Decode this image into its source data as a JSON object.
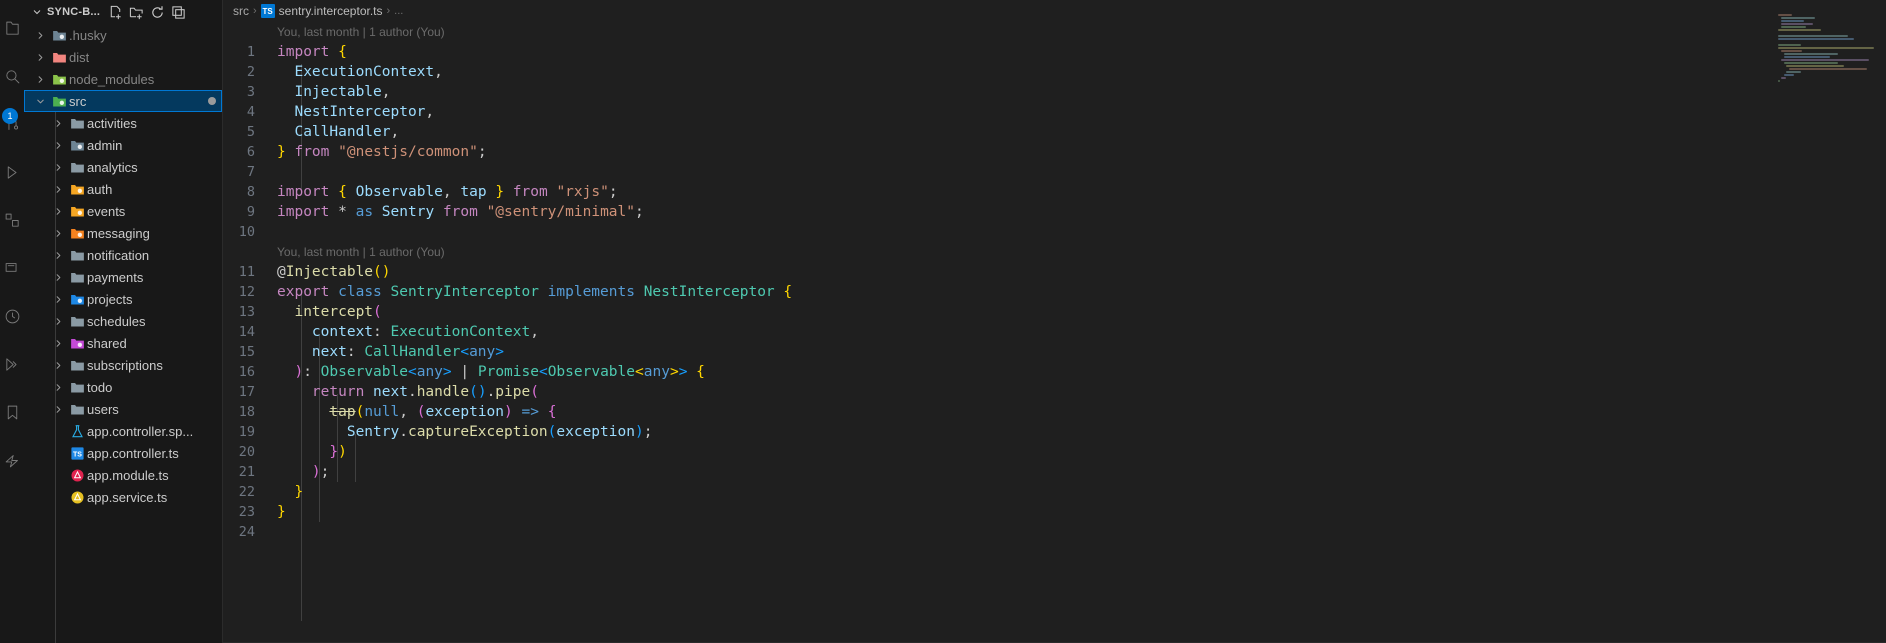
{
  "activity_bar": {
    "items": [
      {
        "name": "explorer-icon",
        "badge": null
      },
      {
        "name": "search-icon",
        "badge": null
      },
      {
        "name": "source-control-icon",
        "badge": "1"
      },
      {
        "name": "run-and-debug-icon",
        "badge": null
      },
      {
        "name": "extensions-icon",
        "badge": null
      },
      {
        "name": "remote-explorer-icon",
        "badge": null
      },
      {
        "name": "testing-icon",
        "badge": null
      },
      {
        "name": "live-share-icon",
        "badge": null
      },
      {
        "name": "bookmarks-icon",
        "badge": null
      },
      {
        "name": "thunder-client-icon",
        "badge": null
      }
    ]
  },
  "sidebar": {
    "title": "SYNC-B...",
    "actions": [
      {
        "name": "new-file-icon",
        "title": "New File..."
      },
      {
        "name": "new-folder-icon",
        "title": "New Folder..."
      },
      {
        "name": "refresh-explorer-icon",
        "title": "Refresh Explorer"
      },
      {
        "name": "collapse-folders-icon",
        "title": "Collapse Folders in Explorer"
      }
    ],
    "items": [
      {
        "label": ".husky",
        "type": "folder",
        "icon": "folder-husky-icon",
        "depth": 1,
        "expandable": true,
        "expanded": false,
        "dim": true,
        "selected": false,
        "modified": false
      },
      {
        "label": "dist",
        "type": "folder",
        "icon": "folder-dist-icon",
        "depth": 1,
        "expandable": true,
        "expanded": false,
        "dim": true,
        "selected": false,
        "modified": false
      },
      {
        "label": "node_modules",
        "type": "folder",
        "icon": "folder-node-icon",
        "depth": 1,
        "expandable": true,
        "expanded": false,
        "dim": true,
        "selected": false,
        "modified": false
      },
      {
        "label": "src",
        "type": "folder",
        "icon": "folder-src-icon",
        "depth": 1,
        "expandable": true,
        "expanded": true,
        "dim": false,
        "selected": true,
        "modified": true
      },
      {
        "label": "activities",
        "type": "folder",
        "icon": "folder-icon",
        "depth": 2,
        "expandable": true,
        "expanded": false,
        "dim": false,
        "selected": false,
        "modified": false
      },
      {
        "label": "admin",
        "type": "folder",
        "icon": "folder-admin-icon",
        "depth": 2,
        "expandable": true,
        "expanded": false,
        "dim": false,
        "selected": false,
        "modified": false
      },
      {
        "label": "analytics",
        "type": "folder",
        "icon": "folder-icon",
        "depth": 2,
        "expandable": true,
        "expanded": false,
        "dim": false,
        "selected": false,
        "modified": false
      },
      {
        "label": "auth",
        "type": "folder",
        "icon": "folder-auth-icon",
        "depth": 2,
        "expandable": true,
        "expanded": false,
        "dim": false,
        "selected": false,
        "modified": false
      },
      {
        "label": "events",
        "type": "folder",
        "icon": "folder-events-icon",
        "depth": 2,
        "expandable": true,
        "expanded": false,
        "dim": false,
        "selected": false,
        "modified": false
      },
      {
        "label": "messaging",
        "type": "folder",
        "icon": "folder-messaging-icon",
        "depth": 2,
        "expandable": true,
        "expanded": false,
        "dim": false,
        "selected": false,
        "modified": false
      },
      {
        "label": "notification",
        "type": "folder",
        "icon": "folder-icon",
        "depth": 2,
        "expandable": true,
        "expanded": false,
        "dim": false,
        "selected": false,
        "modified": false
      },
      {
        "label": "payments",
        "type": "folder",
        "icon": "folder-icon",
        "depth": 2,
        "expandable": true,
        "expanded": false,
        "dim": false,
        "selected": false,
        "modified": false
      },
      {
        "label": "projects",
        "type": "folder",
        "icon": "folder-projects-icon",
        "depth": 2,
        "expandable": true,
        "expanded": false,
        "dim": false,
        "selected": false,
        "modified": false
      },
      {
        "label": "schedules",
        "type": "folder",
        "icon": "folder-icon",
        "depth": 2,
        "expandable": true,
        "expanded": false,
        "dim": false,
        "selected": false,
        "modified": false
      },
      {
        "label": "shared",
        "type": "folder",
        "icon": "folder-shared-icon",
        "depth": 2,
        "expandable": true,
        "expanded": false,
        "dim": false,
        "selected": false,
        "modified": false
      },
      {
        "label": "subscriptions",
        "type": "folder",
        "icon": "folder-icon",
        "depth": 2,
        "expandable": true,
        "expanded": false,
        "dim": false,
        "selected": false,
        "modified": false
      },
      {
        "label": "todo",
        "type": "folder",
        "icon": "folder-icon",
        "depth": 2,
        "expandable": true,
        "expanded": false,
        "dim": false,
        "selected": false,
        "modified": false
      },
      {
        "label": "users",
        "type": "folder",
        "icon": "folder-icon",
        "depth": 2,
        "expandable": true,
        "expanded": false,
        "dim": false,
        "selected": false,
        "modified": false
      },
      {
        "label": "app.controller.sp...",
        "type": "file",
        "icon": "jest-test-icon",
        "depth": 2,
        "expandable": false,
        "expanded": false,
        "dim": false,
        "selected": false,
        "modified": false
      },
      {
        "label": "app.controller.ts",
        "type": "file",
        "icon": "typescript-icon",
        "depth": 2,
        "expandable": false,
        "expanded": false,
        "dim": false,
        "selected": false,
        "modified": false
      },
      {
        "label": "app.module.ts",
        "type": "file",
        "icon": "nest-module-icon",
        "depth": 2,
        "expandable": false,
        "expanded": false,
        "dim": false,
        "selected": false,
        "modified": false
      },
      {
        "label": "app.service.ts",
        "type": "file",
        "icon": "nest-service-icon",
        "depth": 2,
        "expandable": false,
        "expanded": false,
        "dim": false,
        "selected": false,
        "modified": false
      }
    ]
  },
  "editor": {
    "breadcrumb": {
      "root": "src",
      "sep": "›",
      "file": "sentry.interceptor.ts",
      "more": "...",
      "file_badge": "TS"
    },
    "blame_text": "You, last month | 1 author (You)",
    "blame_line_before": [
      1,
      11
    ],
    "lines": [
      {
        "n": 1,
        "tokens": [
          {
            "t": "import",
            "c": "t-kw"
          },
          {
            "t": " ",
            "c": "t-plain"
          },
          {
            "t": "{",
            "c": "b1"
          }
        ]
      },
      {
        "n": 2,
        "tokens": [
          {
            "t": "  ",
            "c": "t-plain"
          },
          {
            "t": "ExecutionContext",
            "c": "t-var"
          },
          {
            "t": ",",
            "c": "t-plain"
          }
        ]
      },
      {
        "n": 3,
        "tokens": [
          {
            "t": "  ",
            "c": "t-plain"
          },
          {
            "t": "Injectable",
            "c": "t-var"
          },
          {
            "t": ",",
            "c": "t-plain"
          }
        ]
      },
      {
        "n": 4,
        "tokens": [
          {
            "t": "  ",
            "c": "t-plain"
          },
          {
            "t": "NestInterceptor",
            "c": "t-var"
          },
          {
            "t": ",",
            "c": "t-plain"
          }
        ]
      },
      {
        "n": 5,
        "tokens": [
          {
            "t": "  ",
            "c": "t-plain"
          },
          {
            "t": "CallHandler",
            "c": "t-var"
          },
          {
            "t": ",",
            "c": "t-plain"
          }
        ]
      },
      {
        "n": 6,
        "tokens": [
          {
            "t": "}",
            "c": "b1"
          },
          {
            "t": " ",
            "c": "t-plain"
          },
          {
            "t": "from",
            "c": "t-kw"
          },
          {
            "t": " ",
            "c": "t-plain"
          },
          {
            "t": "\"@nestjs/common\"",
            "c": "t-str"
          },
          {
            "t": ";",
            "c": "t-plain"
          }
        ]
      },
      {
        "n": 7,
        "tokens": []
      },
      {
        "n": 8,
        "tokens": [
          {
            "t": "import",
            "c": "t-kw"
          },
          {
            "t": " ",
            "c": "t-plain"
          },
          {
            "t": "{",
            "c": "b1"
          },
          {
            "t": " ",
            "c": "t-plain"
          },
          {
            "t": "Observable",
            "c": "t-var"
          },
          {
            "t": ", ",
            "c": "t-plain"
          },
          {
            "t": "tap",
            "c": "t-var"
          },
          {
            "t": " ",
            "c": "t-plain"
          },
          {
            "t": "}",
            "c": "b1"
          },
          {
            "t": " ",
            "c": "t-plain"
          },
          {
            "t": "from",
            "c": "t-kw"
          },
          {
            "t": " ",
            "c": "t-plain"
          },
          {
            "t": "\"rxjs\"",
            "c": "t-str"
          },
          {
            "t": ";",
            "c": "t-plain"
          }
        ]
      },
      {
        "n": 9,
        "tokens": [
          {
            "t": "import",
            "c": "t-kw"
          },
          {
            "t": " ",
            "c": "t-plain"
          },
          {
            "t": "*",
            "c": "t-plain"
          },
          {
            "t": " ",
            "c": "t-plain"
          },
          {
            "t": "as",
            "c": "t-kw2"
          },
          {
            "t": " ",
            "c": "t-plain"
          },
          {
            "t": "Sentry",
            "c": "t-var"
          },
          {
            "t": " ",
            "c": "t-plain"
          },
          {
            "t": "from",
            "c": "t-kw"
          },
          {
            "t": " ",
            "c": "t-plain"
          },
          {
            "t": "\"@sentry/minimal\"",
            "c": "t-str"
          },
          {
            "t": ";",
            "c": "t-plain"
          }
        ]
      },
      {
        "n": 10,
        "tokens": []
      },
      {
        "n": 11,
        "tokens": [
          {
            "t": "@",
            "c": "t-plain"
          },
          {
            "t": "Injectable",
            "c": "t-fn"
          },
          {
            "t": "()",
            "c": "b1"
          }
        ]
      },
      {
        "n": 12,
        "tokens": [
          {
            "t": "export",
            "c": "t-kw"
          },
          {
            "t": " ",
            "c": "t-plain"
          },
          {
            "t": "class",
            "c": "t-kw2"
          },
          {
            "t": " ",
            "c": "t-plain"
          },
          {
            "t": "SentryInterceptor",
            "c": "t-type"
          },
          {
            "t": " ",
            "c": "t-plain"
          },
          {
            "t": "implements",
            "c": "t-kw2"
          },
          {
            "t": " ",
            "c": "t-plain"
          },
          {
            "t": "NestInterceptor",
            "c": "t-type"
          },
          {
            "t": " ",
            "c": "t-plain"
          },
          {
            "t": "{",
            "c": "b1"
          }
        ]
      },
      {
        "n": 13,
        "tokens": [
          {
            "t": "  ",
            "c": "t-plain"
          },
          {
            "t": "intercept",
            "c": "t-fn"
          },
          {
            "t": "(",
            "c": "b2"
          }
        ]
      },
      {
        "n": 14,
        "tokens": [
          {
            "t": "    ",
            "c": "t-plain"
          },
          {
            "t": "context",
            "c": "t-var"
          },
          {
            "t": ": ",
            "c": "t-plain"
          },
          {
            "t": "ExecutionContext",
            "c": "t-type"
          },
          {
            "t": ",",
            "c": "t-plain"
          }
        ]
      },
      {
        "n": 15,
        "tokens": [
          {
            "t": "    ",
            "c": "t-plain"
          },
          {
            "t": "next",
            "c": "t-var"
          },
          {
            "t": ": ",
            "c": "t-plain"
          },
          {
            "t": "CallHandler",
            "c": "t-type"
          },
          {
            "t": "<",
            "c": "b3"
          },
          {
            "t": "any",
            "c": "t-kw2"
          },
          {
            "t": ">",
            "c": "b3"
          }
        ]
      },
      {
        "n": 16,
        "tokens": [
          {
            "t": "  ",
            "c": "t-plain"
          },
          {
            "t": ")",
            "c": "b2"
          },
          {
            "t": ": ",
            "c": "t-plain"
          },
          {
            "t": "Observable",
            "c": "t-type"
          },
          {
            "t": "<",
            "c": "b3"
          },
          {
            "t": "any",
            "c": "t-kw2"
          },
          {
            "t": ">",
            "c": "b3"
          },
          {
            "t": " | ",
            "c": "t-plain"
          },
          {
            "t": "Promise",
            "c": "t-type"
          },
          {
            "t": "<",
            "c": "b3"
          },
          {
            "t": "Observable",
            "c": "t-type"
          },
          {
            "t": "<",
            "c": "b1"
          },
          {
            "t": "any",
            "c": "t-kw2"
          },
          {
            "t": ">",
            "c": "b1"
          },
          {
            "t": ">",
            "c": "b3"
          },
          {
            "t": " ",
            "c": "t-plain"
          },
          {
            "t": "{",
            "c": "b1"
          }
        ]
      },
      {
        "n": 17,
        "tokens": [
          {
            "t": "    ",
            "c": "t-plain"
          },
          {
            "t": "return",
            "c": "t-kw"
          },
          {
            "t": " ",
            "c": "t-plain"
          },
          {
            "t": "next",
            "c": "t-var"
          },
          {
            "t": ".",
            "c": "t-plain"
          },
          {
            "t": "handle",
            "c": "t-fn"
          },
          {
            "t": "()",
            "c": "b3"
          },
          {
            "t": ".",
            "c": "t-plain"
          },
          {
            "t": "pipe",
            "c": "t-fn"
          },
          {
            "t": "(",
            "c": "b2"
          }
        ]
      },
      {
        "n": 18,
        "tokens": [
          {
            "t": "      ",
            "c": "t-plain"
          },
          {
            "t": "tap",
            "c": "t-fn strike"
          },
          {
            "t": "(",
            "c": "b1"
          },
          {
            "t": "null",
            "c": "t-kw2"
          },
          {
            "t": ", ",
            "c": "t-plain"
          },
          {
            "t": "(",
            "c": "b2"
          },
          {
            "t": "exception",
            "c": "t-var"
          },
          {
            "t": ")",
            "c": "b2"
          },
          {
            "t": " ",
            "c": "t-plain"
          },
          {
            "t": "=>",
            "c": "t-kw2"
          },
          {
            "t": " ",
            "c": "t-plain"
          },
          {
            "t": "{",
            "c": "b2"
          }
        ]
      },
      {
        "n": 19,
        "tokens": [
          {
            "t": "        ",
            "c": "t-plain"
          },
          {
            "t": "Sentry",
            "c": "t-var"
          },
          {
            "t": ".",
            "c": "t-plain"
          },
          {
            "t": "captureException",
            "c": "t-fn"
          },
          {
            "t": "(",
            "c": "b3"
          },
          {
            "t": "exception",
            "c": "t-var"
          },
          {
            "t": ")",
            "c": "b3"
          },
          {
            "t": ";",
            "c": "t-plain"
          }
        ]
      },
      {
        "n": 20,
        "tokens": [
          {
            "t": "      ",
            "c": "t-plain"
          },
          {
            "t": "}",
            "c": "b2"
          },
          {
            "t": ")",
            "c": "b1"
          }
        ]
      },
      {
        "n": 21,
        "tokens": [
          {
            "t": "    ",
            "c": "t-plain"
          },
          {
            "t": ")",
            "c": "b2"
          },
          {
            "t": ";",
            "c": "t-plain"
          }
        ]
      },
      {
        "n": 22,
        "tokens": [
          {
            "t": "  ",
            "c": "t-plain"
          },
          {
            "t": "}",
            "c": "b1"
          }
        ]
      },
      {
        "n": 23,
        "tokens": [
          {
            "t": "}",
            "c": "b1"
          }
        ]
      },
      {
        "n": 24,
        "tokens": []
      }
    ]
  },
  "colors": {
    "accent": "#0078d4",
    "editor_bg": "#1f1f1f",
    "sidebar_bg": "#181818",
    "selection_bg": "#04395e"
  }
}
